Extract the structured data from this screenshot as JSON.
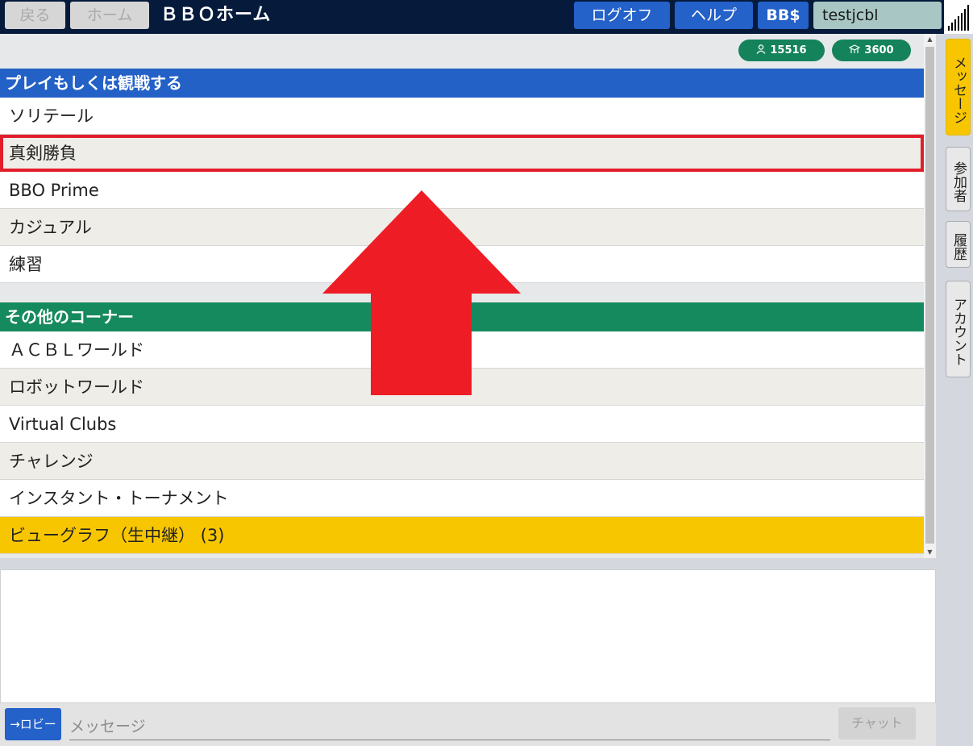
{
  "topbar": {
    "back_label": "戻る",
    "home_label": "ホーム",
    "title": "ＢＢＯホーム",
    "logoff_label": "ログオフ",
    "help_label": "ヘルプ",
    "bbdollars_label": "BB$",
    "username": "testjcbl"
  },
  "stats": {
    "users_icon": "user-icon",
    "users": "15516",
    "tables_icon": "table-icon",
    "tables": "3600"
  },
  "sections": {
    "play": {
      "header": "プレイもしくは観戦する",
      "items": [
        "ソリテール",
        "真剣勝負",
        "BBO Prime",
        "カジュアル",
        "練習"
      ]
    },
    "other": {
      "header": "その他のコーナー",
      "items": [
        "ＡＣＢＬワールド",
        "ロボットワールド",
        "Virtual Clubs",
        "チャレンジ",
        "インスタント・トーナメント",
        "ビューグラフ（生中継） (3)"
      ]
    }
  },
  "tabs": {
    "messages": "メッセージ",
    "players": "参加者",
    "history": "履歴",
    "account": "アカウント"
  },
  "chat": {
    "lobby_button": "→ロビー",
    "input_placeholder": "メッセージ",
    "chat_button": "チャット"
  },
  "colors": {
    "topbar": "#061a3c",
    "play_header": "#2361c7",
    "other_header": "#158a5e",
    "highlight_row": "#f7c600",
    "selection_outline": "#e21e2b",
    "arrow": "#ee1c25"
  }
}
